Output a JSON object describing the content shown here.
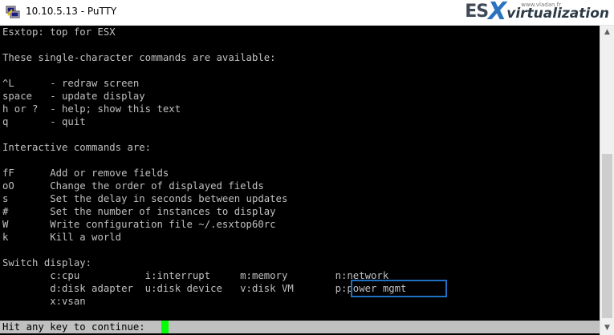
{
  "window": {
    "title": "10.10.5.13 - PuTTY",
    "icon": "putty-icon"
  },
  "watermark": {
    "esx": "ES",
    "x": "X",
    "virt": "virtualization",
    "url": "www.vladan.fr"
  },
  "terminal": {
    "lines": [
      "Esxtop: top for ESX",
      "",
      "These single-character commands are available:",
      "",
      "^L      - redraw screen",
      "space   - update display",
      "h or ?  - help; show this text",
      "q       - quit",
      "",
      "Interactive commands are:",
      "",
      "fF      Add or remove fields",
      "oO      Change the order of displayed fields",
      "s       Set the delay in seconds between updates",
      "#       Set the number of instances to display",
      "W       Write configuration file ~/.esxtop60rc",
      "k       Kill a world",
      "",
      "Switch display:",
      "        c:cpu           i:interrupt     m:memory        n:network",
      "        d:disk adapter  u:disk device   v:disk VM       p:power mgmt",
      "        x:vsan"
    ],
    "prompt": "Hit any key to continue: ",
    "highlight_color": "#1f6fc5",
    "cursor_color": "#00ff00"
  },
  "scrollbar": {
    "up_icon": "scroll-up-arrow-icon",
    "down_icon": "scroll-down-arrow-icon"
  }
}
